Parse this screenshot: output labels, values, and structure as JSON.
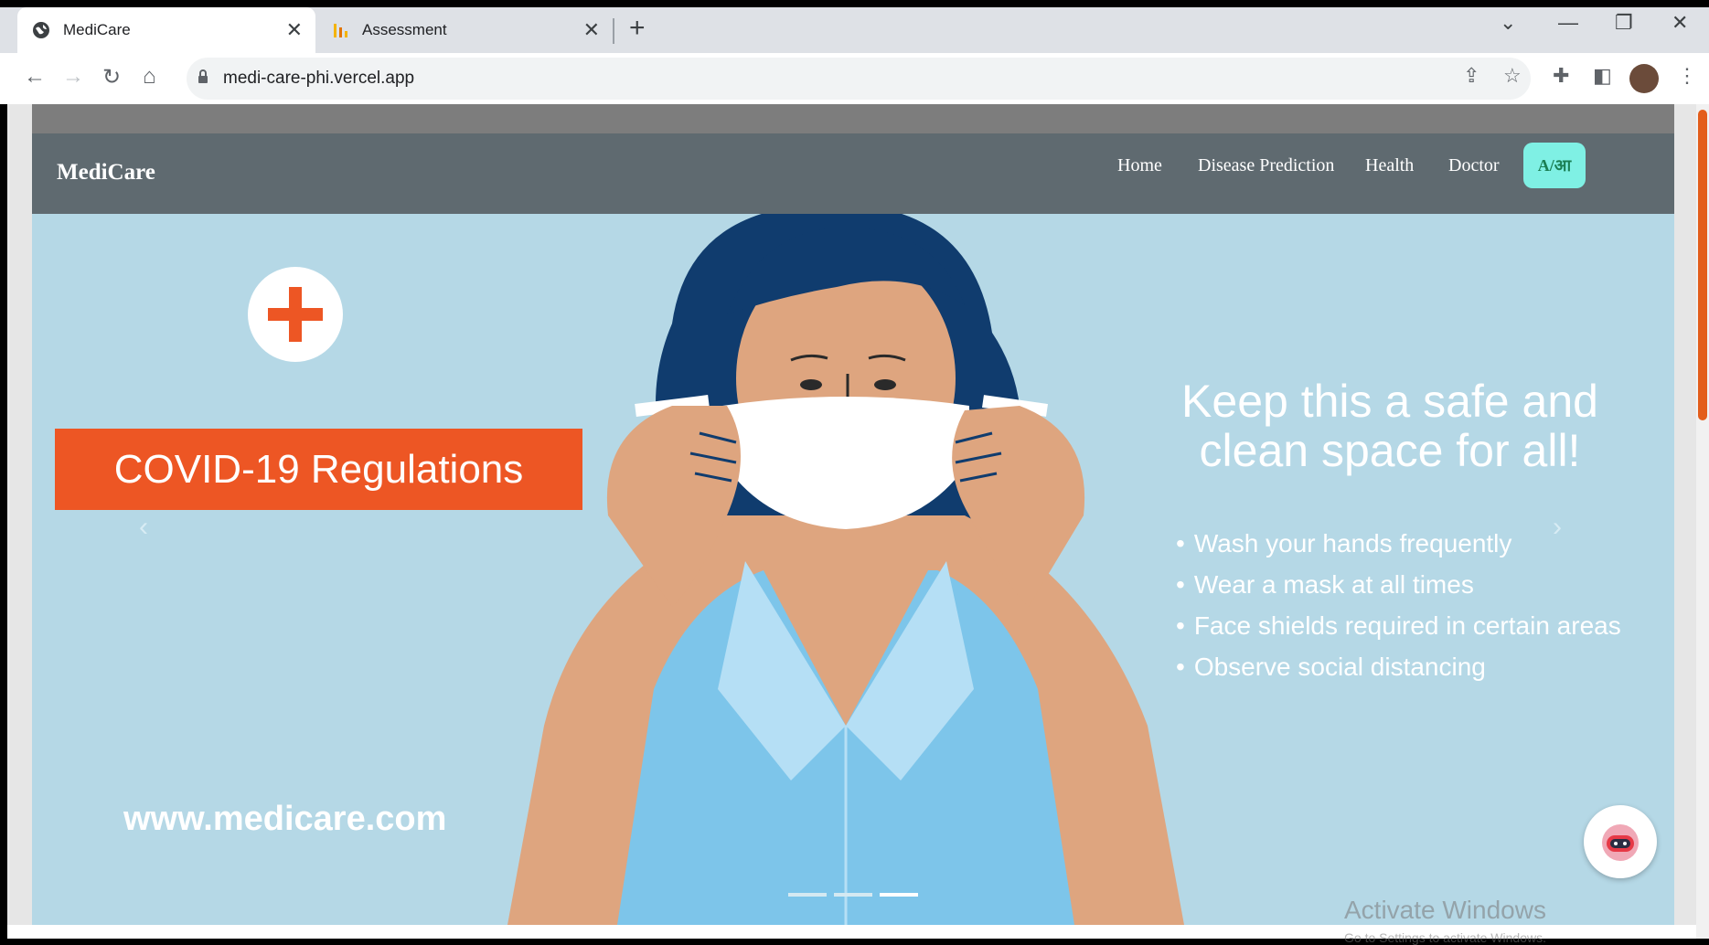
{
  "browser": {
    "tabs": [
      {
        "title": "MediCare",
        "icon": "globe-icon",
        "active": true
      },
      {
        "title": "Assessment",
        "icon": "analytics-icon",
        "active": false
      }
    ],
    "url": "medi-care-phi.vercel.app"
  },
  "site": {
    "brand": "MediCare",
    "nav": [
      "Home",
      "Disease Prediction",
      "Health",
      "Doctor"
    ],
    "lang_toggle": "A/आ"
  },
  "hero": {
    "banner": "COVID-19 Regulations",
    "title_line1": "Keep this a safe and",
    "title_line2": "clean space for all!",
    "bullets": [
      "Wash your hands frequently",
      "Wear a mask at all times",
      "Face shields required in certain areas",
      "Observe social distancing"
    ],
    "website": "www.medicare.com",
    "slides": 3,
    "active_slide": 3
  },
  "watermark": {
    "line1": "Activate Windows",
    "line2": "Go to Settings to activate Windows."
  },
  "colors": {
    "accent_orange": "#ed5624",
    "hero_bg": "#b5d8e6",
    "nav_bg": "#5f6a70",
    "hair": "#103c6e",
    "skin": "#dea57f",
    "shirt": "#7dc5ea",
    "lang_btn": "#7ff0e4"
  }
}
